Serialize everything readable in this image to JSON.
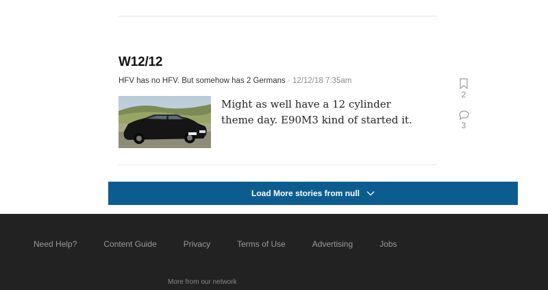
{
  "story": {
    "title": "W12/12",
    "author": "HFV has no HFV. But somehow has 2 Germans",
    "separator": "·",
    "timestamp": "12/12/18 7:35am",
    "excerpt": "Might as well have a 12 cylinder theme day. E90M3 kind of started it.",
    "thumbnail_icon": "black-sedan-photo",
    "bookmark": {
      "icon": "bookmark-icon",
      "count": "2"
    },
    "comments": {
      "icon": "comment-bubble-icon",
      "count": "3"
    }
  },
  "load_more": {
    "label": "Load More stories from null",
    "icon": "chevron-down-icon",
    "color": "#0d5c8f"
  },
  "footer": {
    "background": "#222222",
    "links": [
      "Need Help?",
      "Content Guide",
      "Privacy",
      "Terms of Use",
      "Advertising",
      "Jobs"
    ],
    "network_label": "More from our network"
  }
}
